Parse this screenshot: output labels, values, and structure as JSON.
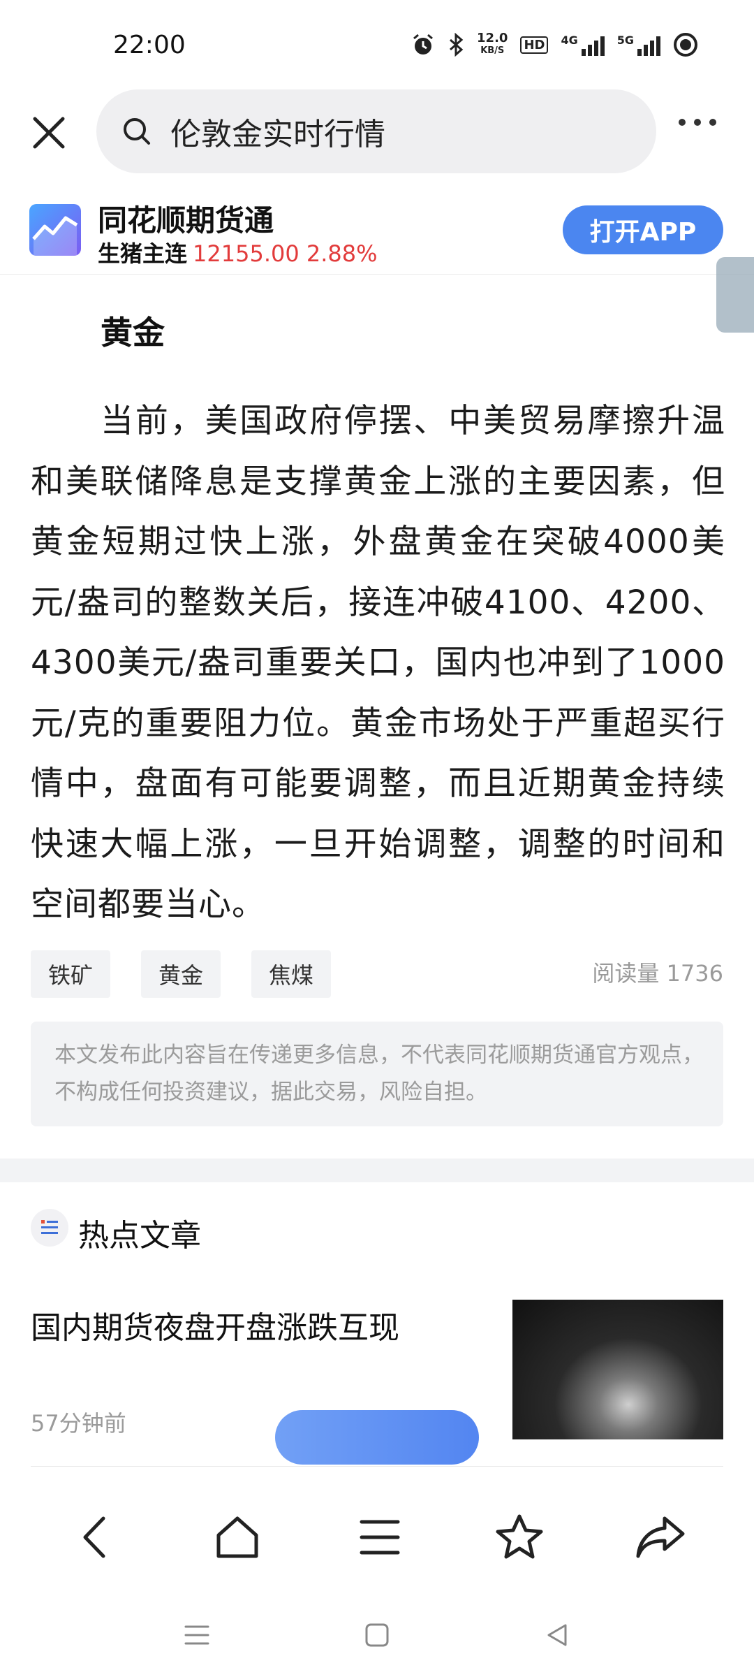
{
  "status_bar": {
    "time": "22:00",
    "net_speed_value": "12.0",
    "net_speed_unit": "KB/S",
    "hd_label": "HD",
    "signal1_label": "4G",
    "signal2_label": "5G",
    "icons": [
      "alarm-icon",
      "bluetooth-icon",
      "hd-icon",
      "signal-icon",
      "signal-icon",
      "battery-icon"
    ]
  },
  "search": {
    "query": "伦敦金实时行情"
  },
  "app_banner": {
    "name": "同花顺期货通",
    "ticker_name": "生猪主连",
    "ticker_value": "12155.00 2.88%",
    "open_label": "打开APP",
    "accent": "#4b86f0",
    "up_color": "#e23b3b"
  },
  "article": {
    "heading": "黄金",
    "body": "当前，美国政府停摆、中美贸易摩擦升温和美联储降息是支撑黄金上涨的主要因素，但黄金短期过快上涨，外盘黄金在突破4000美元/盎司的整数关后，接连冲破4100、4200、4300美元/盎司重要关口，国内也冲到了1000元/克的重要阻力位。黄金市场处于严重超买行情中，盘面有可能要调整，而且近期黄金持续快速大幅上涨，一旦开始调整，调整的时间和空间都要当心。",
    "tags": [
      "铁矿",
      "黄金",
      "焦煤"
    ],
    "read_count": "阅读量 1736",
    "disclaimer": "本文发布此内容旨在传递更多信息，不代表同花顺期货通官方观点，不构成任何投资建议，据此交易，风险自担。"
  },
  "hot": {
    "title": "热点文章",
    "items": [
      {
        "title": "国内期货夜盘开盘涨跌互现",
        "time": "57分钟前"
      }
    ]
  },
  "nav": {
    "icons": [
      "back-icon",
      "home-icon",
      "menu-icon",
      "star-icon",
      "share-icon"
    ]
  }
}
